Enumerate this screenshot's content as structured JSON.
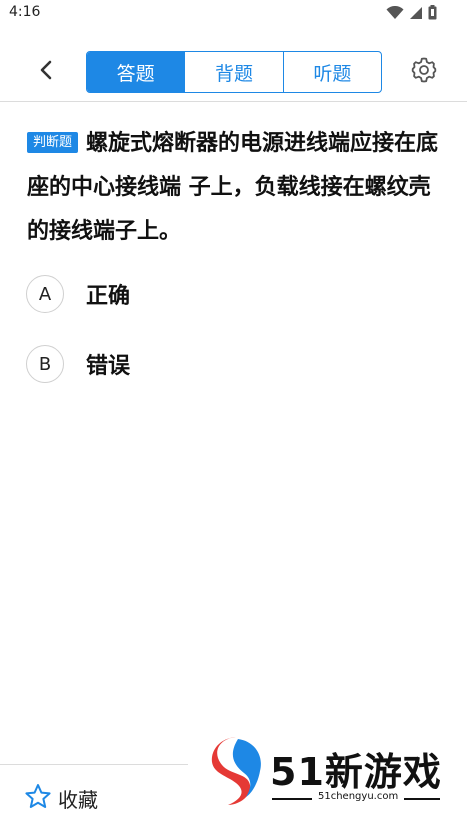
{
  "status_bar": {
    "time": "4:16",
    "icons": [
      "wifi-icon",
      "signal-icon",
      "battery-icon"
    ]
  },
  "header": {
    "back_icon": "chevron-left-icon",
    "tabs": [
      {
        "label": "答题",
        "active": true
      },
      {
        "label": "背题",
        "active": false
      },
      {
        "label": "听题",
        "active": false
      }
    ],
    "settings_icon": "gear-icon"
  },
  "question": {
    "type_badge": "判断题",
    "text": "螺旋式熔断器的电源进线端应接在底座的中心接线端 子上，负载线接在螺纹壳的接线端子上。"
  },
  "options": [
    {
      "letter": "A",
      "text": "正确"
    },
    {
      "letter": "B",
      "text": "错误"
    }
  ],
  "footer": {
    "favorite_label": "收藏",
    "favorite_icon": "star-outline-icon"
  },
  "watermark": {
    "brand": "51新游戏",
    "url": "51chengyu.com"
  },
  "colors": {
    "accent": "#1e88e5",
    "text": "#111111",
    "divider": "#dcdcdc"
  }
}
